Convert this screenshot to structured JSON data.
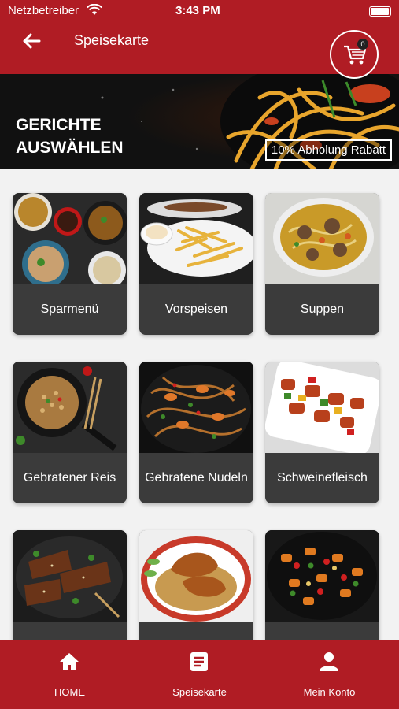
{
  "status_bar": {
    "carrier": "Netzbetreiber",
    "time": "3:43 PM"
  },
  "header": {
    "title": "Speisekarte",
    "cart_count": "0"
  },
  "banner": {
    "line1": "GERICHTE",
    "line2": "AUSWÄHLEN",
    "discount": "10% Abholung Rabatt"
  },
  "categories": [
    {
      "label": "Sparmenü"
    },
    {
      "label": "Vorspeisen"
    },
    {
      "label": "Suppen"
    },
    {
      "label": "Gebratener Reis"
    },
    {
      "label": "Gebratene Nudeln"
    },
    {
      "label": "Schweinefleisch"
    },
    {
      "label": ""
    },
    {
      "label": ""
    },
    {
      "label": ""
    }
  ],
  "bottom_nav": [
    {
      "label": "HOME",
      "icon": "home-icon"
    },
    {
      "label": "Speisekarte",
      "icon": "menu-list-icon"
    },
    {
      "label": "Mein Konto",
      "icon": "user-icon"
    }
  ],
  "colors": {
    "brand": "#b01c24",
    "card": "#3b3b3b"
  }
}
